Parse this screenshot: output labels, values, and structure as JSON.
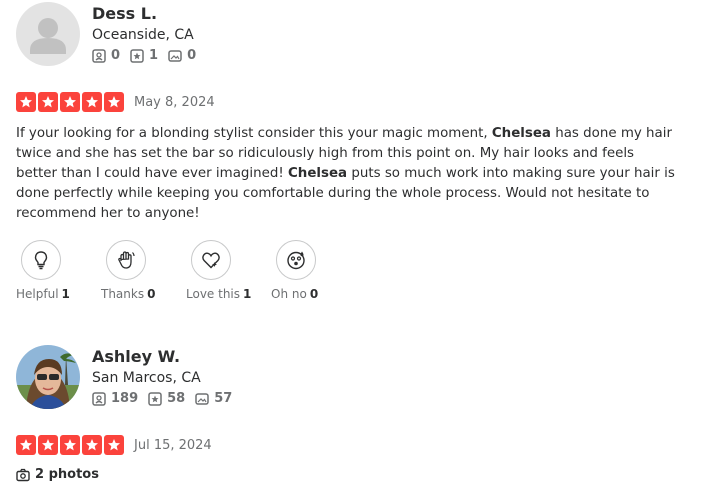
{
  "reviews": [
    {
      "user": {
        "name": "Dess L.",
        "location": "Oceanside, CA",
        "reviews": "0",
        "friends": "1",
        "photos": "0"
      },
      "date": "May 8, 2024",
      "rating": 5,
      "text_parts": [
        "If your looking for a blonding stylist consider this your magic moment, ",
        "Chelsea",
        " has done my hair twice and she has set the bar so ridiculously high from this point on. My hair looks and feels better than I could have ever imagined! ",
        "Chelsea",
        " puts so much work into making sure your hair is done perfectly while keeping you comfortable during the whole process. Would not hesitate to recommend her to anyone!"
      ],
      "reactions": [
        {
          "label": "Helpful",
          "count": "1"
        },
        {
          "label": "Thanks",
          "count": "0"
        },
        {
          "label": "Love this",
          "count": "1"
        },
        {
          "label": "Oh no",
          "count": "0"
        }
      ]
    },
    {
      "user": {
        "name": "Ashley W.",
        "location": "San Marcos, CA",
        "reviews": "189",
        "friends": "58",
        "photos": "57"
      },
      "date": "Jul 15, 2024",
      "rating": 5,
      "photos_label": "2 photos"
    }
  ],
  "colors": {
    "star": "#fb433c",
    "muted": "#6e7072",
    "text": "#2d2e2f"
  },
  "icons": {
    "reviews": "review-icon",
    "friends": "star-badge-icon",
    "photos": "photo-icon",
    "helpful": "lightbulb-icon",
    "thanks": "wave-hand-icon",
    "love": "heart-icon",
    "ohno": "surprised-face-icon"
  }
}
